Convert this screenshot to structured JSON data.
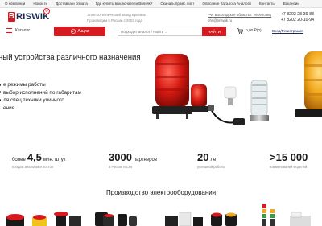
{
  "topnav": {
    "links": [
      "О компании",
      "Новости",
      "Доставка и оплата",
      "Где купить выключатели Briswik?",
      "Скачать прайс лист",
      "Описание Каталога Аналоги",
      "Контакты",
      "Вакансии"
    ]
  },
  "header": {
    "logo_text": "RISWIK",
    "logo_letter": "B",
    "desc_line1": "Электротехнический завод Брисвик",
    "desc_line2": "Производим в России с 2003 года",
    "addr_line1": "РФ, Вологодская область г. Череповец",
    "addr_line2": "bhs@briswik.ru",
    "phone1": "+7 8202 28-39-83",
    "phone2": "+7 8202 20-10-94"
  },
  "searchbar": {
    "catalog_label": "Каталог",
    "promo_label": "Акции",
    "search_placeholder": "Подходит аналог / Найти ...",
    "search_button": "НАЙТИ",
    "cart_value": "0,00 ₽(0)",
    "login_label": "Вход/Регистрация"
  },
  "hero": {
    "title": "ный устройства различного назначения",
    "bullets": [
      "е режимы работы",
      "выбор исполнений по габаритам",
      "ля спец техники уличного",
      "ения"
    ]
  },
  "stats": [
    {
      "pre": "более",
      "big": "4,5",
      "post": "млн. штук",
      "sub": "продаж аналогов и постов"
    },
    {
      "pre": "",
      "big": "3000",
      "post": "партнеров",
      "sub": "в России и СНГ"
    },
    {
      "pre": "",
      "big": "20",
      "post": "лет",
      "sub": "успешной работы"
    },
    {
      "pre": "",
      "big": ">15 000",
      "post": "",
      "sub": "наименований моделей"
    }
  ],
  "production": {
    "title": "Производство электрооборудования"
  },
  "colors": {
    "accent": "#d71920",
    "brand_dark": "#1b2a55",
    "amber": "#f2a81d"
  }
}
